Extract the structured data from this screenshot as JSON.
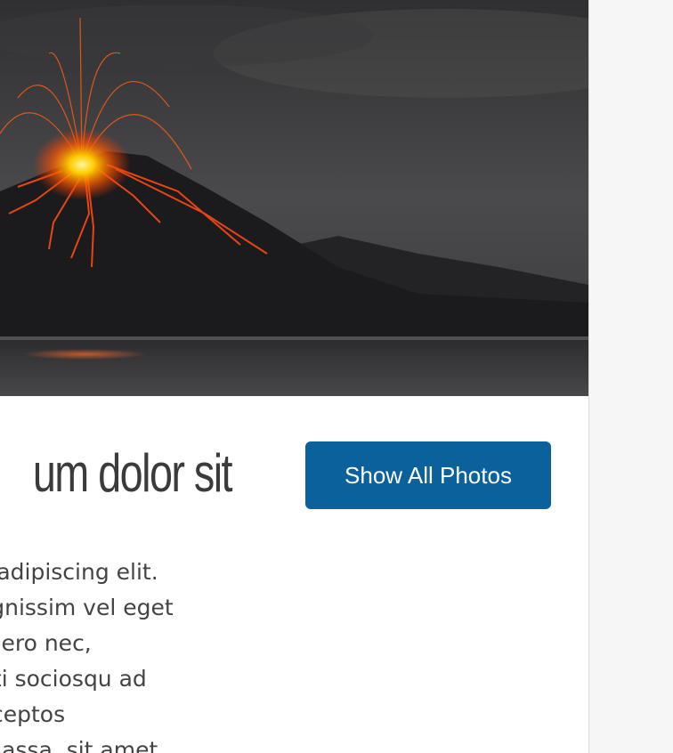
{
  "article": {
    "hero_image_alt": "",
    "title": "um dolor sit",
    "button_label": "Show All Photos",
    "body_lines": [
      "olor sit amet, consectetur adipiscing elit.",
      "e nisl a lacus venenatis dignissim vel eget",
      " lorem nibh, placerat vel libero nec,",
      "da dolor. Class aptent taciti sociosqu ad",
      "per conubia nostra, per inceptos",
      "entesque eleifend purus massa, sit amet"
    ]
  },
  "colors": {
    "button_bg": "#0a619b",
    "page_bg": "#f6f6f6",
    "card_bg": "#ffffff",
    "title_text": "#3b3b3b"
  }
}
